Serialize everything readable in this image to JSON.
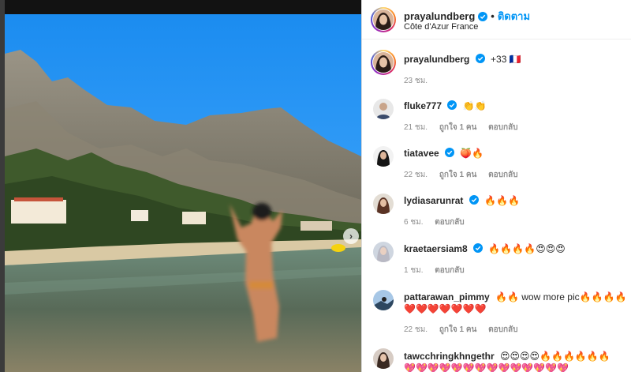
{
  "post": {
    "username": "prayalundberg",
    "follow_label": "ติดตาม",
    "location": "Côte d'Azur France"
  },
  "caption": {
    "username": "prayalundberg",
    "text": "+33 🇫🇷",
    "time": "23 ชม."
  },
  "comments": [
    {
      "username": "fluke777",
      "text": "👏👏",
      "time": "21 ชม.",
      "likes": "ถูกใจ 1 คน",
      "reply": "ตอบกลับ"
    },
    {
      "username": "tiatavee",
      "text": "🍑🔥",
      "time": "22 ชม.",
      "likes": "ถูกใจ 1 คน",
      "reply": "ตอบกลับ"
    },
    {
      "username": "lydiasarunrat",
      "text": "🔥🔥🔥",
      "time": "6 ชม.",
      "likes": "",
      "reply": "ตอบกลับ"
    },
    {
      "username": "kraetaersiam8",
      "text": "🔥🔥🔥🔥😍😍😍",
      "time": "1 ชม.",
      "likes": "",
      "reply": "ตอบกลับ"
    },
    {
      "username": "pattarawan_pimmy",
      "text": "🔥🔥 wow more pic🔥🔥🔥🔥",
      "text2": "❤️❤️❤️❤️❤️❤️❤️",
      "time": "22 ชม.",
      "likes": "ถูกใจ 1 คน",
      "reply": "ตอบกลับ"
    },
    {
      "username": "tawcchringkhngethr",
      "text": "😍😍😍😍🔥🔥🔥🔥🔥🔥",
      "text2": "💖💖💖💖💖💖💖💖💖💖💖💖💖💖"
    }
  ],
  "icons": {
    "verified": "verified-badge-icon",
    "next": "chevron-right-icon"
  },
  "colors": {
    "verified": "#0095f6",
    "follow": "#0095f6",
    "meta": "#8e8e8e",
    "sky": "#1e90ff"
  }
}
